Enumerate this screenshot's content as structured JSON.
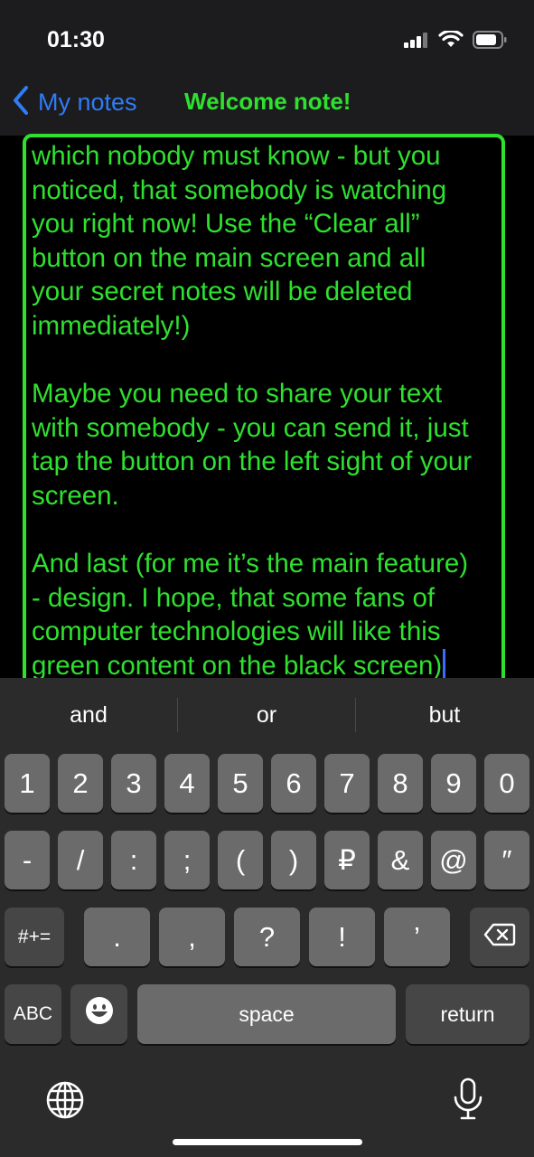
{
  "status_bar": {
    "time": "01:30"
  },
  "nav": {
    "back_label": "My notes",
    "title": "Welcome note!"
  },
  "note": {
    "text": "which nobody must know - but you\nnoticed, that somebody is watching\nyou right now! Use the “Clear all”\nbutton on the main screen and all\nyour secret notes will be deleted\nimmediately!)\n\nMaybe you need to share your text\nwith somebody - you can send it, just\ntap the button on the left sight of your\nscreen.\n\nAnd last (for me it’s the main feature)\n- design. I hope, that some fans of\ncomputer technologies will like this\ngreen content on the black screen)"
  },
  "keyboard": {
    "suggestions": [
      "and",
      "or",
      "but"
    ],
    "row1": [
      "1",
      "2",
      "3",
      "4",
      "5",
      "6",
      "7",
      "8",
      "9",
      "0"
    ],
    "row2": [
      "-",
      "/",
      ":",
      ";",
      "(",
      ")",
      "₽",
      "&",
      "@",
      "″"
    ],
    "row3": {
      "shift": "#+=",
      "keys": [
        ".",
        ",",
        "?",
        "!",
        "’"
      ]
    },
    "row4": {
      "abc": "ABC",
      "space": "space",
      "return": "return"
    }
  },
  "colors": {
    "accent_green": "#2fe02f",
    "link_blue": "#2f7cf6",
    "background": "#000000"
  },
  "icons": [
    "signal-icon",
    "wifi-icon",
    "battery-icon",
    "back-chevron-icon",
    "delete-icon",
    "emoji-icon",
    "globe-icon",
    "mic-icon"
  ]
}
